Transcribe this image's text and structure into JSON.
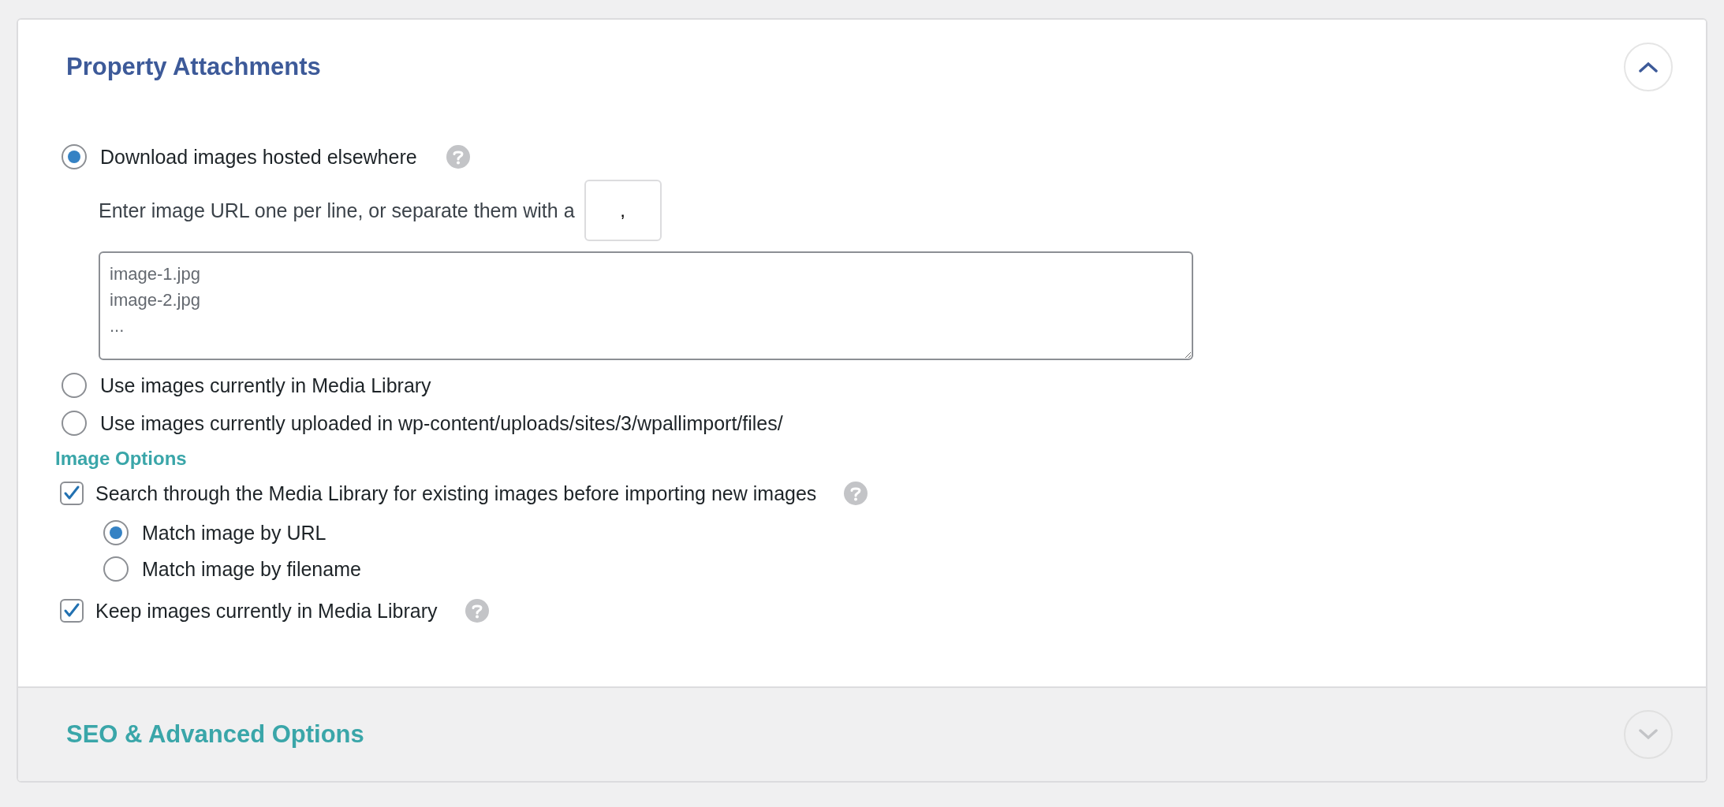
{
  "sections": [
    {
      "title": "Property Attachments",
      "expanded": true,
      "sources": [
        {
          "kind": "radio",
          "label": "Download images hosted elsewhere",
          "selected": true,
          "help": true,
          "separator_label": "Enter image URL one per line, or separate them with a",
          "separator": ",",
          "urls_placeholder": "image-1.jpg\nimage-2.jpg\n..."
        },
        {
          "kind": "radio",
          "label": "Use images currently in Media Library",
          "selected": false,
          "help": false
        },
        {
          "kind": "radio",
          "label": "Use images currently uploaded in wp-content/uploads/sites/3/wpallimport/files/",
          "selected": false,
          "help": false
        }
      ],
      "options_heading": "Image Options",
      "options": [
        {
          "label": "Search through the Media Library for existing images before importing new images",
          "checked": true,
          "help": true,
          "children": [
            {
              "label": "Match image by URL",
              "selected": true
            },
            {
              "label": "Match image by filename",
              "selected": false
            }
          ]
        },
        {
          "label": "Keep images currently in Media Library",
          "checked": true,
          "help": true
        }
      ]
    },
    {
      "title": "SEO & Advanced Options",
      "expanded": false
    }
  ]
}
